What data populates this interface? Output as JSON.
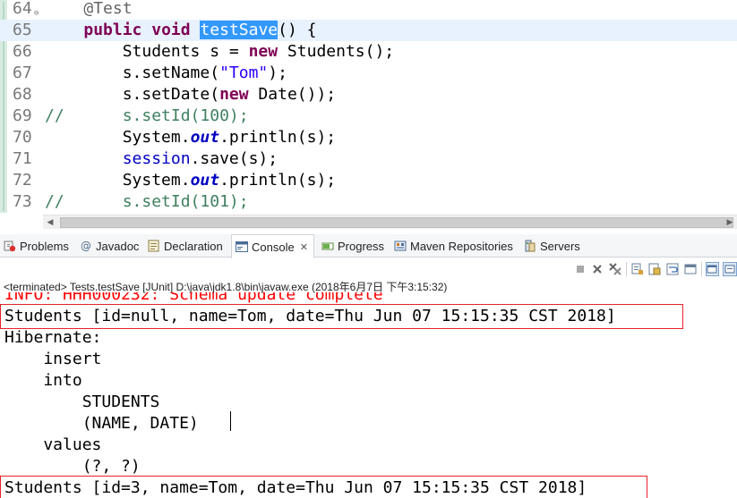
{
  "editor": {
    "lines": [
      {
        "num": "64",
        "fold": true,
        "tokens": [
          {
            "t": "    ",
            "c": ""
          },
          {
            "t": "@Test",
            "c": "ann"
          }
        ]
      },
      {
        "num": "65",
        "current": true,
        "tokens": [
          {
            "t": "    ",
            "c": ""
          },
          {
            "t": "public",
            "c": "kw"
          },
          {
            "t": " ",
            "c": ""
          },
          {
            "t": "void",
            "c": "kw"
          },
          {
            "t": " ",
            "c": ""
          },
          {
            "t": "testSave",
            "c": "sel"
          },
          {
            "t": "() {",
            "c": ""
          }
        ]
      },
      {
        "num": "66",
        "tokens": [
          {
            "t": "        Students s = ",
            "c": ""
          },
          {
            "t": "new",
            "c": "kw"
          },
          {
            "t": " Students();",
            "c": ""
          }
        ]
      },
      {
        "num": "67",
        "tokens": [
          {
            "t": "        s.setName(",
            "c": ""
          },
          {
            "t": "\"Tom\"",
            "c": "str"
          },
          {
            "t": ");",
            "c": ""
          }
        ]
      },
      {
        "num": "68",
        "tokens": [
          {
            "t": "        s.setDate(",
            "c": ""
          },
          {
            "t": "new",
            "c": "kw"
          },
          {
            "t": " Date());",
            "c": ""
          }
        ]
      },
      {
        "num": "69",
        "tokens": [
          {
            "t": "//      s.setId(100);",
            "c": "cmt"
          }
        ]
      },
      {
        "num": "70",
        "tokens": [
          {
            "t": "        System.",
            "c": ""
          },
          {
            "t": "out",
            "c": "sfld"
          },
          {
            "t": ".println(s);",
            "c": ""
          }
        ]
      },
      {
        "num": "71",
        "tokens": [
          {
            "t": "        ",
            "c": ""
          },
          {
            "t": "session",
            "c": "fld"
          },
          {
            "t": ".save(s);",
            "c": ""
          }
        ]
      },
      {
        "num": "72",
        "tokens": [
          {
            "t": "        System.",
            "c": ""
          },
          {
            "t": "out",
            "c": "sfld"
          },
          {
            "t": ".println(s);",
            "c": ""
          }
        ]
      },
      {
        "num": "73",
        "tokens": [
          {
            "t": "//      s.setId(101);",
            "c": "cmt"
          }
        ]
      }
    ]
  },
  "tabs": [
    {
      "label": "Problems",
      "icon": "problems-icon"
    },
    {
      "label": "Javadoc",
      "icon": "javadoc-icon"
    },
    {
      "label": "Declaration",
      "icon": "declaration-icon"
    },
    {
      "label": "Console",
      "icon": "console-icon",
      "active": true,
      "close": "✕"
    },
    {
      "label": "Progress",
      "icon": "progress-icon"
    },
    {
      "label": "Maven Repositories",
      "icon": "maven-repositories-icon"
    },
    {
      "label": "Servers",
      "icon": "servers-icon"
    }
  ],
  "console": {
    "status": "<terminated> Tests.testSave [JUnit] D:\\java\\jdk1.8\\bin\\javaw.exe (2018年6月7日 下午3:15:32)",
    "lines": [
      {
        "text": "INFO: HHH000232: Schema update complete",
        "kind": "err"
      },
      {
        "text": "Students [id=null, name=Tom, date=Thu Jun 07 15:15:35 CST 2018]",
        "kind": "out",
        "boxed": true
      },
      {
        "text": "Hibernate: ",
        "kind": "out"
      },
      {
        "text": "    insert ",
        "kind": "out"
      },
      {
        "text": "    into",
        "kind": "out"
      },
      {
        "text": "        STUDENTS",
        "kind": "out"
      },
      {
        "text": "        (NAME, DATE) ",
        "kind": "out"
      },
      {
        "text": "    values",
        "kind": "out"
      },
      {
        "text": "        (?, ?)",
        "kind": "out"
      },
      {
        "text": "Students [id=3, name=Tom, date=Thu Jun 07 15:15:35 CST 2018]",
        "kind": "out",
        "boxed": true
      }
    ]
  },
  "colors": {
    "highlight_box": "#e8222a",
    "selection": "#3399ff",
    "current_line": "#e8f2fe",
    "keyword": "#7f0055",
    "comment": "#3f7f5f",
    "string": "#2a00ff",
    "error_text": "#ff0000"
  }
}
